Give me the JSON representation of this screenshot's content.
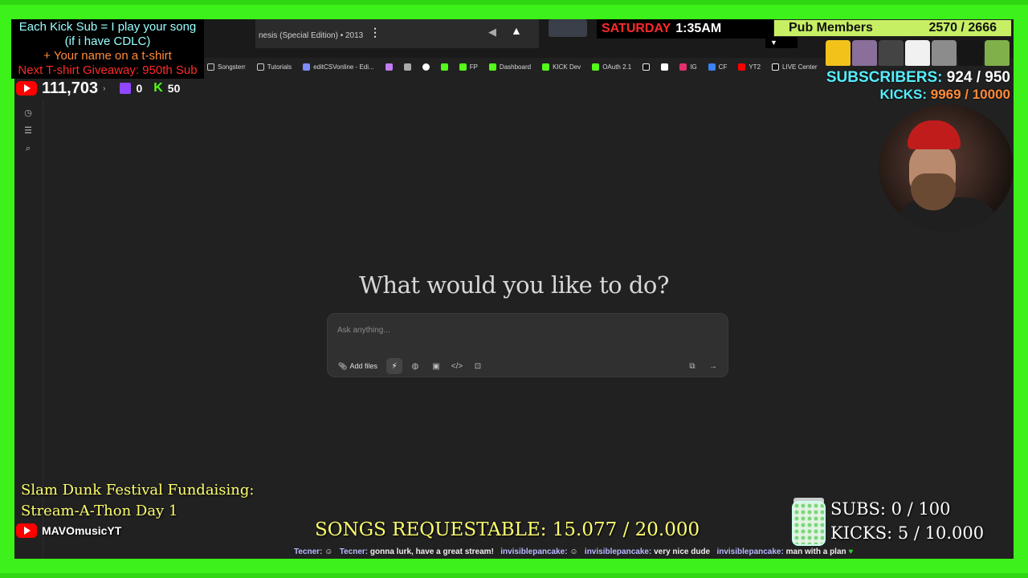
{
  "overlay": {
    "kick_sub": {
      "line1": "Each Kick Sub = I play your song",
      "line2": "(if i have CDLC)",
      "line3": "+ Your name on a t-shirt",
      "line4": "Next T-shirt Giveaway: 950th Sub"
    },
    "stats": {
      "youtube_count": "111,703",
      "twitch_count": "0",
      "kick_count": "50"
    },
    "date_time": {
      "day": "SATURDAY",
      "time": "1:35AM"
    },
    "pub_members": {
      "label": "Pub Members",
      "value": "2570 / 2666"
    },
    "subscribers": {
      "label": "SUBSCRIBERS:",
      "value": "924 / 950"
    },
    "kicks": {
      "label": "KICKS:",
      "value": "9969 / 10000"
    },
    "fundraiser": {
      "line1": "Slam Dunk Festival Fundaising:",
      "line2": "Stream-A-Thon Day 1"
    },
    "channel": "MAVOmusicYT",
    "songs_requestable": "SONGS REQUESTABLE: 15.077 / 20.000",
    "goals": {
      "subs": "SUBS:  0 / 100",
      "kicks": "KICKS: 5 / 10.000"
    },
    "chat": [
      {
        "user": "Tecner:",
        "msg": ""
      },
      {
        "user": "Tecner:",
        "msg": "gonna lurk, have a great stream!"
      },
      {
        "user": "invisiblepancake:",
        "msg": ""
      },
      {
        "user": "invisiblepancake:",
        "msg": "very nice dude"
      },
      {
        "user": "invisiblepancake:",
        "msg": "man with a plan"
      }
    ],
    "shirt_colors": [
      "#f2c21b",
      "#8a6f9a",
      "#444444",
      "#f1f1f1",
      "#8c8c8c",
      "#161616",
      "#7fb04a"
    ]
  },
  "browser": {
    "media_title": "nesis (Special Edition) • 2013",
    "bookmarks": [
      {
        "label": "Songsterr",
        "icon": "folder-icon"
      },
      {
        "label": "Tutorials",
        "icon": "folder-icon"
      },
      {
        "label": "editCSVonline - Edi...",
        "icon": "csv-icon"
      },
      {
        "label": "",
        "icon": "colorful-icon"
      },
      {
        "label": "",
        "icon": "shield-icon"
      },
      {
        "label": "",
        "icon": "google-icon"
      },
      {
        "label": "",
        "icon": "kick-icon"
      },
      {
        "label": "FP",
        "icon": "kick-icon"
      },
      {
        "label": "Dashboard",
        "icon": "kick-icon"
      },
      {
        "label": "KICK Dev",
        "icon": "kick-icon"
      },
      {
        "label": "OAuth 2.1",
        "icon": "kick-icon"
      },
      {
        "label": "",
        "icon": "tiktok-icon"
      },
      {
        "label": "",
        "icon": "p-icon"
      },
      {
        "label": "IG",
        "icon": "instagram-icon"
      },
      {
        "label": "CF",
        "icon": "cf-icon"
      },
      {
        "label": "YT2",
        "icon": "youtube-icon"
      },
      {
        "label": "LIVE Center",
        "icon": "tiktok-icon"
      }
    ]
  },
  "app": {
    "heading": "What would you like to do?",
    "input_placeholder": "Ask anything...",
    "add_files_label": "Add files",
    "tools": [
      "agent-icon",
      "globe-icon",
      "image-icon",
      "code-icon",
      "canvas-icon"
    ],
    "right_tools": [
      "layout-icon",
      "send-arrow-icon"
    ]
  }
}
